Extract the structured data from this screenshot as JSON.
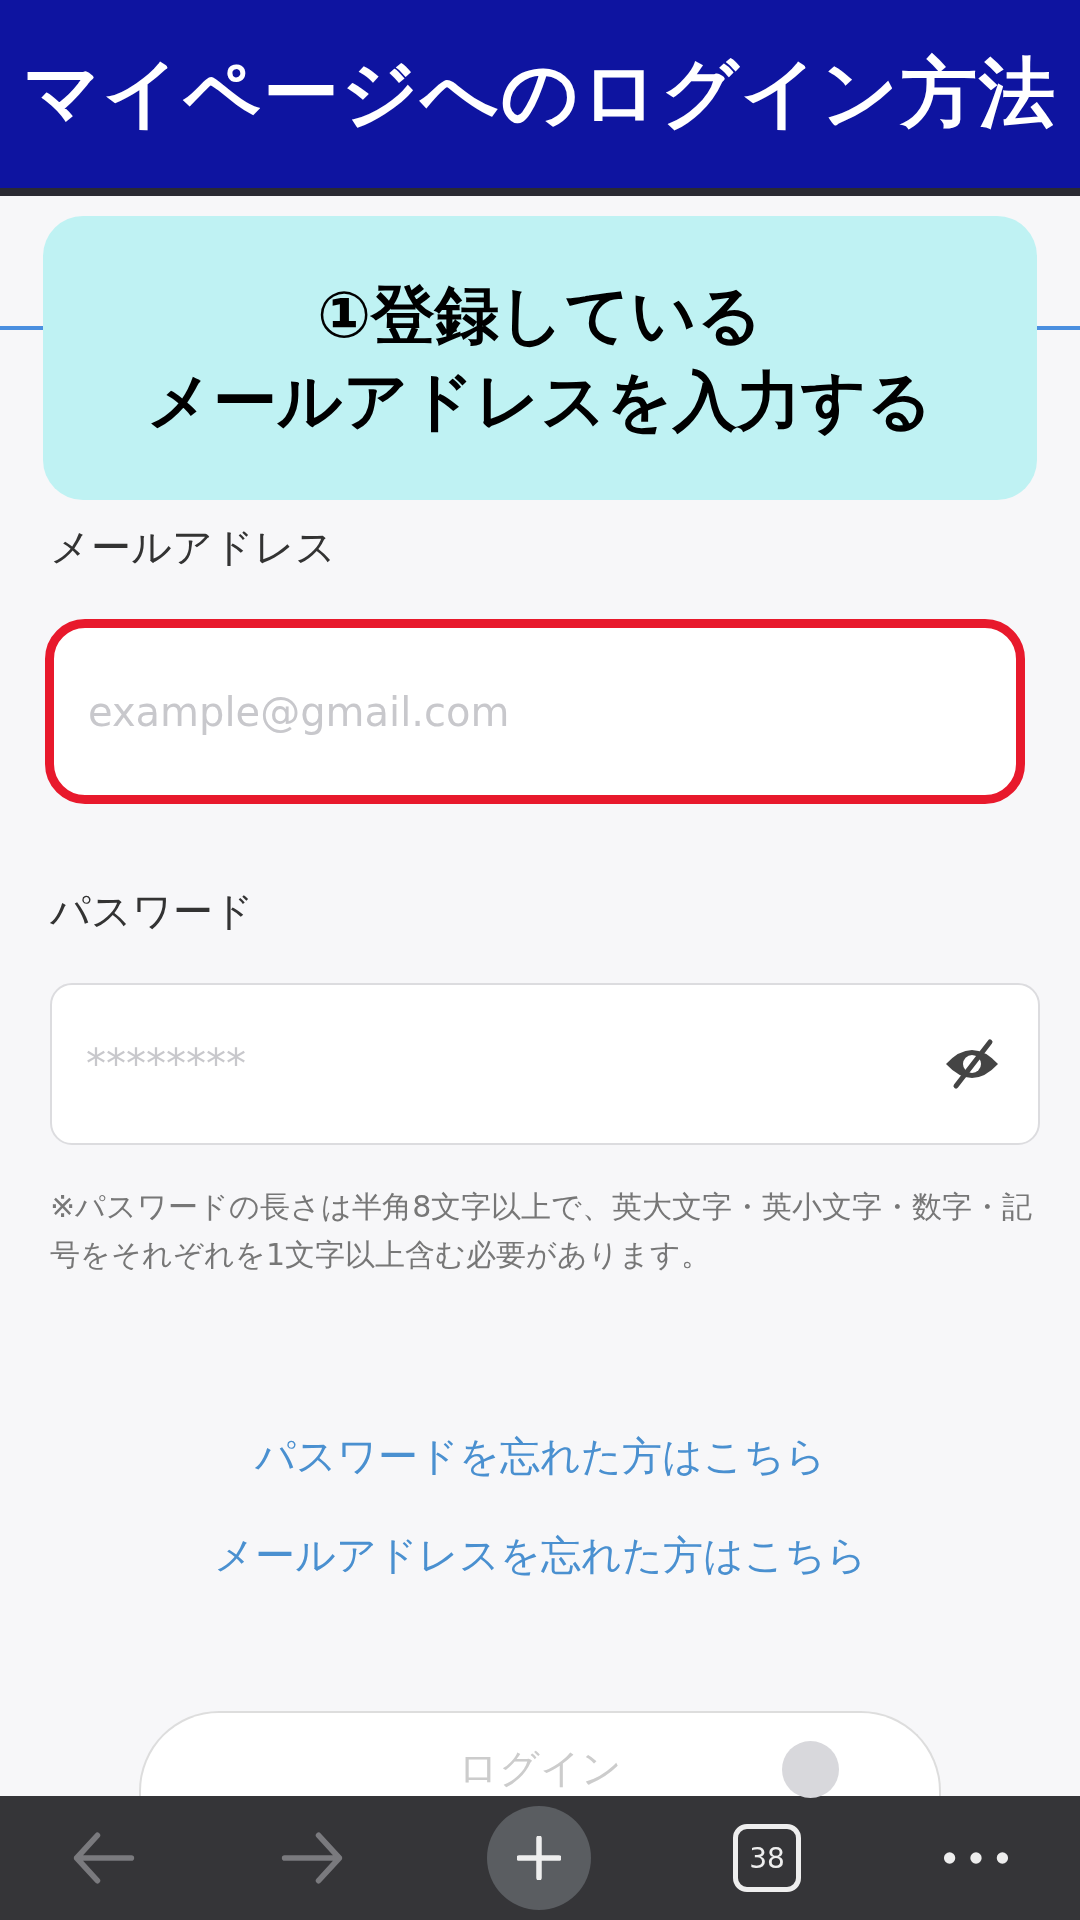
{
  "header": {
    "title": "マイページへのログイン方法"
  },
  "callout": {
    "lines": [
      "①登録している",
      "メールアドレスを入力する"
    ]
  },
  "fields": [
    {
      "kind": "email",
      "label": "メールアドレス",
      "placeholder": "example@gmail.com",
      "highlighted": true
    },
    {
      "kind": "password",
      "label": "パスワード",
      "placeholder": "********",
      "highlighted": false
    }
  ],
  "password_note": "※パスワードの長さは半角8文字以上で、英大文字・英小文字・数字・記号をそれぞれを1文字以上含む必要があります。",
  "links": [
    "パスワードを忘れた方はこちら",
    "メールアドレスを忘れた方はこちら"
  ],
  "login_button": {
    "label": "ログイン"
  },
  "toolbar": {
    "tab_count": "38"
  }
}
